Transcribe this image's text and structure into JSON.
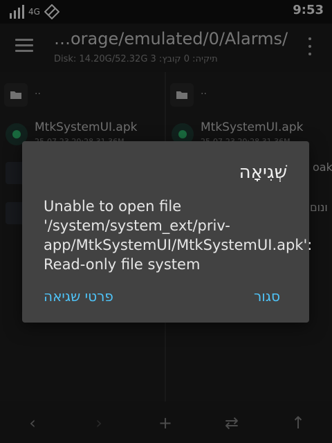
{
  "status": {
    "network": "4G",
    "time": "9:53"
  },
  "appbar": {
    "title": "…orage/emulated/0/Alarms/",
    "subtitle": "Disk: 14.20G/52.32G  3 :תיקיה: 0 קובץ",
    "icons": [
      "menu-icon",
      "overflow-menu-icon"
    ]
  },
  "left_pane": {
    "parent": "..",
    "file": {
      "name": "MtkSystemUI.apk",
      "meta": "25-07-23 20:28 31.36M"
    }
  },
  "right_pane": {
    "parent": "..",
    "file": {
      "name": "MtkSystemUI.apk",
      "meta": "25-07-23 20:28 31.36M"
    },
    "partial_1": "oak",
    "partial_2": "ונום"
  },
  "dialog": {
    "title": "שְׁגִיאָה",
    "message": "Unable to open file '/system/system_ext/priv-app/MtkSystemUI/MtkSystemUI.apk': Read-only file system",
    "details_label": "פרטי שגיאה",
    "close_label": "סגור"
  },
  "bottombar": {
    "icons": [
      "back-icon",
      "forward-icon",
      "add-icon",
      "swap-icon",
      "up-icon"
    ]
  },
  "colors": {
    "accent": "#4fc3f7",
    "dialog_bg": "#424242"
  }
}
